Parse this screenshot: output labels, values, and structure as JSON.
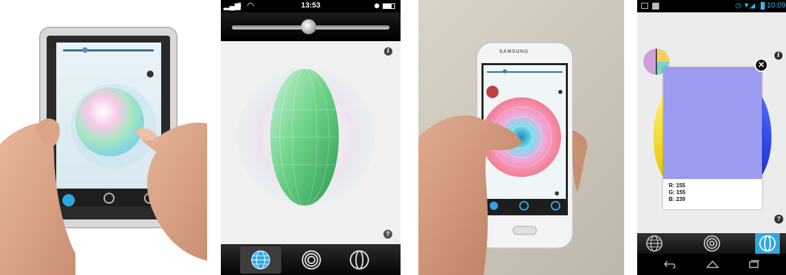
{
  "panel2": {
    "status_signal": "3",
    "status_time": "13:53"
  },
  "panel3": {
    "phone_brand": "SAMSUNG"
  },
  "panel4": {
    "status_time": "10:09",
    "rgb": {
      "r_label": "R:",
      "r_value": "155",
      "g_label": "G:",
      "g_value": "155",
      "b_label": "B:",
      "b_value": "239"
    },
    "swatch_color": "#9b9bef"
  },
  "icons": {
    "info": "i",
    "help": "?",
    "close": "×"
  },
  "colors": {
    "tab_active": "#2ea7e0",
    "android_bar": "#111111"
  }
}
